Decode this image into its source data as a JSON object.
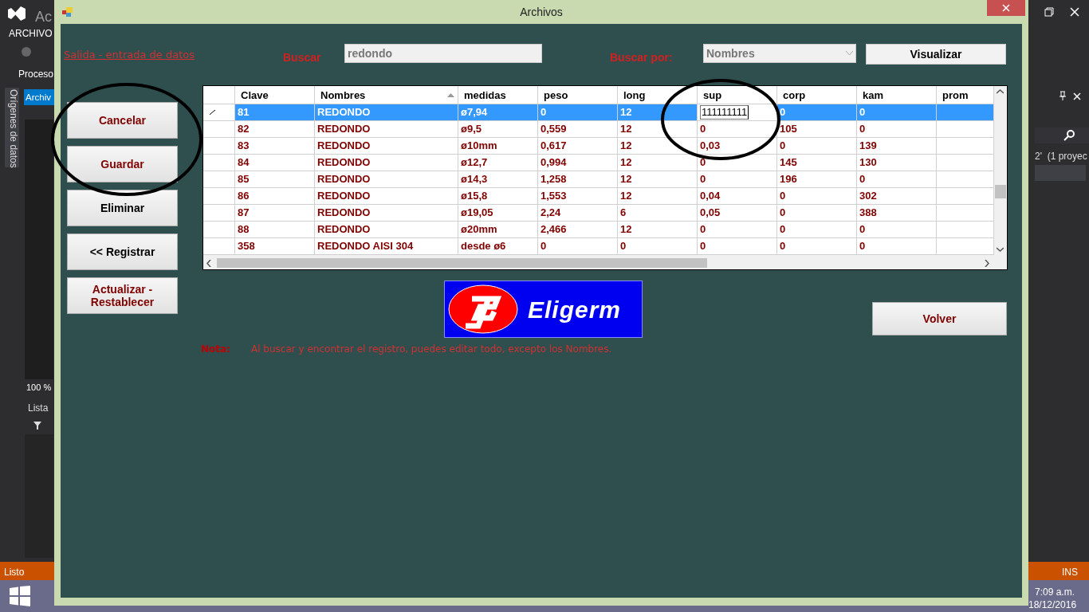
{
  "ide": {
    "title": "Ac",
    "menu": "ARCHIVO",
    "toolbar_label": "Proceso",
    "side_tab": "Orígenes de datos",
    "doc_tab": "Archiv",
    "zoom": "100 %",
    "panel_title": "Lista",
    "solution_text": "2'  (1 proyec",
    "status": "Listo",
    "status_right": "INS"
  },
  "taskbar": {
    "time": "7:09 a.m.",
    "date": "18/12/2016"
  },
  "window": {
    "title": "Archivos"
  },
  "link": "Salida - entrada de datos",
  "search": {
    "label": "Buscar",
    "value": "redondo",
    "by_label": "Buscar por:",
    "by_value": "Nombres",
    "button": "Visualizar"
  },
  "side_buttons": [
    "Cancelar",
    "Guardar",
    "Eliminar",
    "<< Registrar",
    "Actualizar - Restablecer"
  ],
  "table": {
    "columns": [
      {
        "label": "Clave",
        "sorted": false
      },
      {
        "label": "Nombres",
        "sorted": true
      },
      {
        "label": "medidas",
        "sorted": false
      },
      {
        "label": "peso",
        "sorted": false
      },
      {
        "label": "long",
        "sorted": false
      },
      {
        "label": "sup",
        "sorted": false
      },
      {
        "label": "corp",
        "sorted": false
      },
      {
        "label": "kam",
        "sorted": false
      },
      {
        "label": "prom",
        "sorted": false
      }
    ],
    "rows": [
      {
        "selected": true,
        "cells": [
          "81",
          "REDONDO",
          "ø7,94",
          "0",
          "12",
          {
            "text": "111111111",
            "editing": true
          },
          "0",
          "0",
          ""
        ]
      },
      {
        "selected": false,
        "cells": [
          "82",
          "REDONDO",
          "ø9,5",
          "0,559",
          "12",
          "0",
          "105",
          "0",
          ""
        ]
      },
      {
        "selected": false,
        "cells": [
          "83",
          "REDONDO",
          "ø10mm",
          "0,617",
          "12",
          "0,03",
          "0",
          "139",
          ""
        ]
      },
      {
        "selected": false,
        "cells": [
          "84",
          "REDONDO",
          "ø12,7",
          "0,994",
          "12",
          "0",
          "145",
          "130",
          ""
        ]
      },
      {
        "selected": false,
        "cells": [
          "85",
          "REDONDO",
          "ø14,3",
          "1,258",
          "12",
          "0",
          "196",
          "0",
          ""
        ]
      },
      {
        "selected": false,
        "cells": [
          "86",
          "REDONDO",
          "ø15,8",
          "1,553",
          "12",
          "0,04",
          "0",
          "302",
          ""
        ]
      },
      {
        "selected": false,
        "cells": [
          "87",
          "REDONDO",
          "ø19,05",
          "2,24",
          "6",
          "0,05",
          "0",
          "388",
          ""
        ]
      },
      {
        "selected": false,
        "cells": [
          "88",
          "REDONDO",
          "ø20mm",
          "2,466",
          "12",
          "0",
          "0",
          "0",
          ""
        ]
      },
      {
        "selected": false,
        "cells": [
          "358",
          "REDONDO AISI 304",
          "desde ø6",
          "0",
          "0",
          "0",
          "0",
          "0",
          ""
        ]
      }
    ]
  },
  "logo": {
    "text": "Eligerm"
  },
  "volver": "Volver",
  "note": {
    "label": "Nota:",
    "text": "Al buscar y encontrar el registro, puedes editar todo, excepto los Nombres."
  }
}
